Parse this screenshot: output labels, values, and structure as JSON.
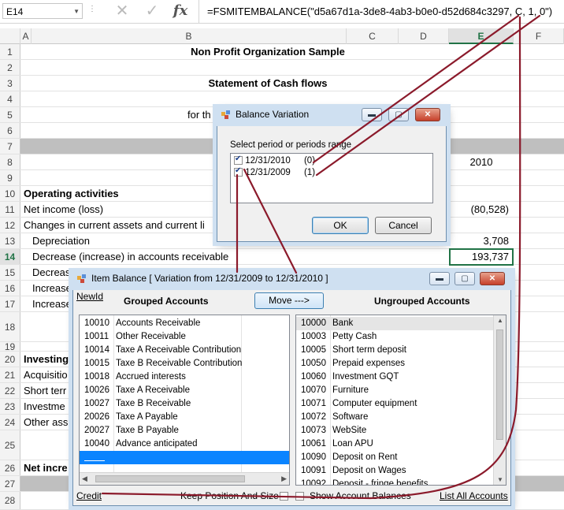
{
  "formula_bar": {
    "name_box": "E14",
    "formula": "=FSMITEMBALANCE(\"d5a67d1a-3de8-4ab3-b0e0-d52d684c3297, C, 1, 0\")"
  },
  "sheet": {
    "columns": [
      "A",
      "B",
      "C",
      "D",
      "E",
      "F"
    ],
    "rows": {
      "r1": {
        "num": "1",
        "b": "Non Profit Organization Sample"
      },
      "r2": {
        "num": "2"
      },
      "r3": {
        "num": "3",
        "b": "Statement of Cash flows"
      },
      "r4": {
        "num": "4"
      },
      "r5": {
        "num": "5",
        "b": "for th"
      },
      "r6": {
        "num": "6"
      },
      "r7": {
        "num": "7"
      },
      "r8": {
        "num": "8",
        "e": "2010"
      },
      "r9": {
        "num": "9"
      },
      "r10": {
        "num": "10",
        "b": "Operating activities"
      },
      "r11": {
        "num": "11",
        "b": "Net income (loss)",
        "e": "(80,528)"
      },
      "r12": {
        "num": "12",
        "b": "Changes in current assets and current li"
      },
      "r13": {
        "num": "13",
        "b": "Depreciation",
        "e": "3,708"
      },
      "r14": {
        "num": "14",
        "b": "Decrease (increase) in accounts receivable",
        "e": "193,737"
      },
      "r15": {
        "num": "15",
        "b": "Decreas"
      },
      "r16": {
        "num": "16",
        "b": "Increase"
      },
      "r17": {
        "num": "17",
        "b": "Increase"
      },
      "r18": {
        "num": "18"
      },
      "r19": {
        "num": "19"
      },
      "r20": {
        "num": "20",
        "b": "Investing"
      },
      "r21": {
        "num": "21",
        "b": "Acquisitio"
      },
      "r22": {
        "num": "22",
        "b": "Short terr"
      },
      "r23": {
        "num": "23",
        "b": "Investme"
      },
      "r24": {
        "num": "24",
        "b": "Other ass"
      },
      "r25": {
        "num": "25"
      },
      "r26": {
        "num": "26",
        "b": "Net incre"
      },
      "r27": {
        "num": "27"
      },
      "r28": {
        "num": "28"
      }
    }
  },
  "balance_variation": {
    "title": "Balance Variation",
    "prompt": "Select period or periods range",
    "periods": [
      {
        "date": "12/31/2010",
        "offset": "(0)",
        "checked": true
      },
      {
        "date": "12/31/2009",
        "offset": "(1)",
        "checked": true
      }
    ],
    "ok_label": "OK",
    "cancel_label": "Cancel"
  },
  "item_balance": {
    "title": "Item Balance [ Variation from 12/31/2009 to 12/31/2010 ]",
    "newid_link": "NewId",
    "grouped_header": "Grouped Accounts",
    "move_button": "Move --->",
    "ungrouped_header": "Ungrouped Accounts",
    "grouped": [
      {
        "code": "10010",
        "name": "Accounts Receivable"
      },
      {
        "code": "10011",
        "name": "Other Receivable"
      },
      {
        "code": "10014",
        "name": "Taxe A Receivable Contribution"
      },
      {
        "code": "10015",
        "name": "Taxe B Receivable Contribution"
      },
      {
        "code": "10018",
        "name": "Accrued interests"
      },
      {
        "code": "10026",
        "name": "Taxe A Receivable"
      },
      {
        "code": "10027",
        "name": "Taxe B Receivable"
      },
      {
        "code": "20026",
        "name": "Taxe A Payable"
      },
      {
        "code": "20027",
        "name": "Taxe B Payable"
      },
      {
        "code": "10040",
        "name": "Advance anticipated"
      }
    ],
    "ungrouped": [
      {
        "code": "10000",
        "name": "Bank"
      },
      {
        "code": "10003",
        "name": "Petty Cash"
      },
      {
        "code": "10005",
        "name": "Short term deposit"
      },
      {
        "code": "10050",
        "name": "Prepaid expenses"
      },
      {
        "code": "10060",
        "name": "Investment GQT"
      },
      {
        "code": "10070",
        "name": "Furniture"
      },
      {
        "code": "10071",
        "name": "Computer equipment"
      },
      {
        "code": "10072",
        "name": "Software"
      },
      {
        "code": "10073",
        "name": "WebSite"
      },
      {
        "code": "10061",
        "name": "Loan APU"
      },
      {
        "code": "10090",
        "name": "Deposit on Rent"
      },
      {
        "code": "10091",
        "name": "Deposit on Wages"
      },
      {
        "code": "10092",
        "name": "Deposit - fringe benefits"
      }
    ],
    "credit_link": "Credit",
    "keep_position_label": "Keep Position And Size",
    "show_balances_label": "Show Account Balances",
    "list_all_link": "List All Accounts"
  },
  "colors": {
    "annotation": "#8b1a2b",
    "excel_green": "#217346",
    "selection_blue": "#0a84ff"
  }
}
